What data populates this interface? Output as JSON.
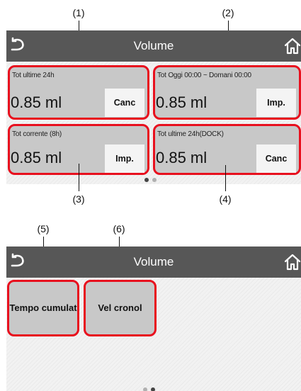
{
  "callouts": [
    "(1)",
    "(2)",
    "(3)",
    "(4)",
    "(5)",
    "(6)"
  ],
  "screen1": {
    "title": "Volume",
    "icons": [
      "back-icon",
      "home-icon"
    ],
    "tiles": [
      {
        "label": "Tot ultime 24h",
        "value": "0.85 ml",
        "button": "Canc"
      },
      {
        "label": "Tot Oggi 00:00 ~ Domani 00:00",
        "value": "0.85 ml",
        "button": "Imp."
      },
      {
        "label": "Tot corrente (8h)",
        "value": "0.85 ml",
        "button": "Imp."
      },
      {
        "label": "Tot ultime 24h(DOCK)",
        "value": "0.85 ml",
        "button": "Canc"
      }
    ],
    "pager": {
      "pages": 2,
      "current": 1
    }
  },
  "screen2": {
    "title": "Volume",
    "icons": [
      "back-icon",
      "home-icon"
    ],
    "tiles": [
      {
        "label": "Tempo cumulat"
      },
      {
        "label": "Vel cronol"
      }
    ],
    "pager": {
      "pages": 2,
      "current": 2
    }
  },
  "colors": {
    "title_bar": "#575757",
    "highlight_border": "#e8101e",
    "tile": "#c8c8c8",
    "button": "#f4f4f4"
  }
}
